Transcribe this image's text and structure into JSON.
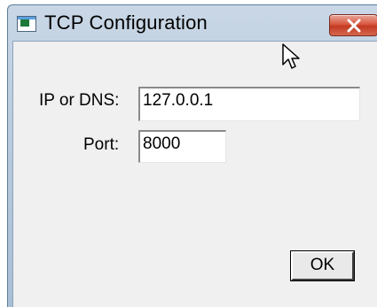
{
  "window": {
    "title": "TCP Configuration",
    "icon": "app-window-icon",
    "close_icon": "close-icon"
  },
  "form": {
    "ip_label": "IP or DNS:",
    "ip_value": "127.0.0.1",
    "port_label": "Port:",
    "port_value": "8000"
  },
  "buttons": {
    "ok_label": "OK"
  },
  "colors": {
    "title_bar": "#b7c9dc",
    "close_button": "#d9573f",
    "client_bg": "#f0f0f0"
  }
}
